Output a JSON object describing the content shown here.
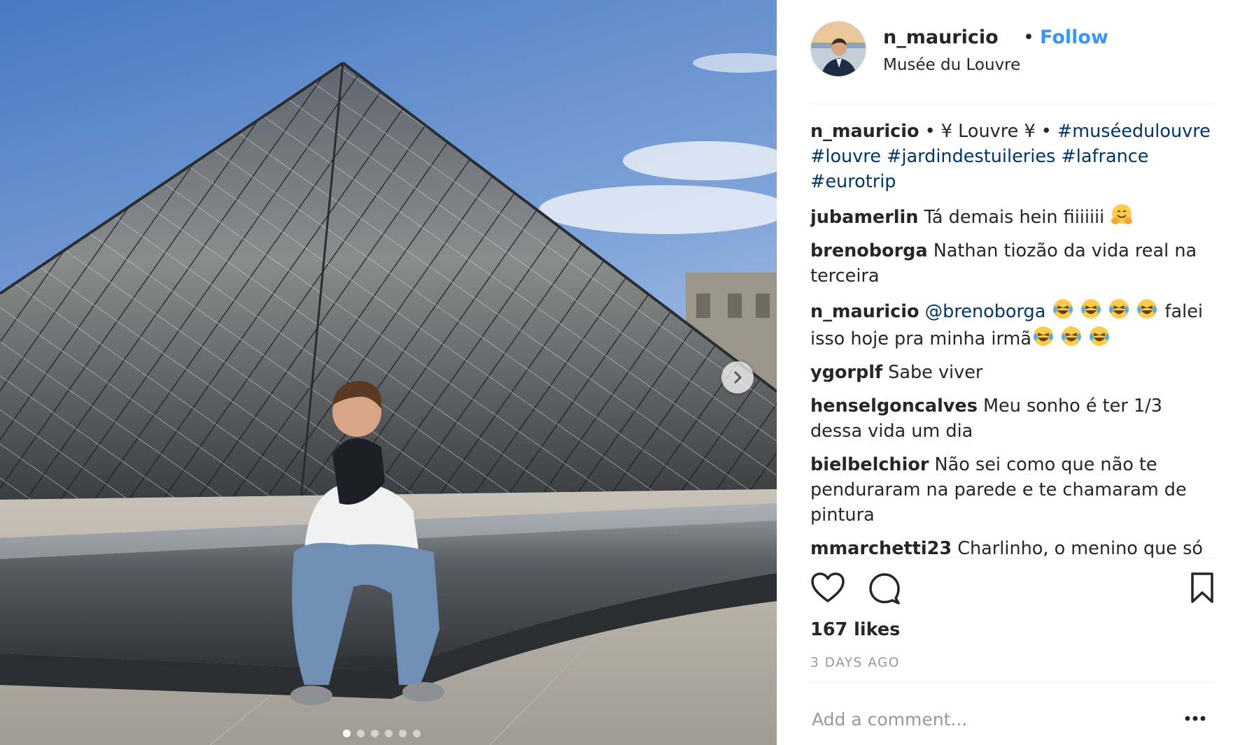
{
  "post": {
    "author": "n_mauricio",
    "separator": "•",
    "follow_label": "Follow",
    "location": "Musée du Louvre",
    "avatar_icon": "profile-photo",
    "media": {
      "description_icon": "louvre-pyramid-photo",
      "next_icon": "chevron-right-icon",
      "carousel_count": 6,
      "carousel_active": 0
    }
  },
  "caption": {
    "user": "n_mauricio",
    "text": " • ¥ Louvre ¥ • ",
    "tags": [
      "#muséedulouvre",
      "#louvre",
      "#jardindestuileries",
      "#lafrance",
      "#eurotrip"
    ]
  },
  "comments": [
    {
      "user": "jubamerlin",
      "text": " Tá demais hein fiiiiiii "
    },
    {
      "user": "brenoborga",
      "text": " Nathan tiozão da vida real na terceira"
    },
    {
      "user": "n_mauricio",
      "mention": "@brenoborga",
      "text_after": " falei isso hoje pra minha irmã"
    },
    {
      "user": "ygorplf",
      "text": " Sabe viver"
    },
    {
      "user": "henselgoncalves",
      "text": " Meu sonho é ter 1/3 dessa vida um dia"
    },
    {
      "user": "bielbelchior",
      "text": " Não sei como que não te penduraram na parede e te chamaram de pintura"
    },
    {
      "user": "mmarchetti23",
      "text": " Charlinho, o menino que só"
    }
  ],
  "actions": {
    "like_icon": "heart-icon",
    "comment_icon": "comment-icon",
    "save_icon": "bookmark-icon",
    "more_icon": "more-options-icon"
  },
  "likes": "167 likes",
  "timestamp": "3 DAYS AGO",
  "add_comment_placeholder": "Add a comment...",
  "colors": {
    "link": "#3897f0",
    "hashtag": "#003569",
    "muted": "#999999",
    "text": "#262626"
  }
}
